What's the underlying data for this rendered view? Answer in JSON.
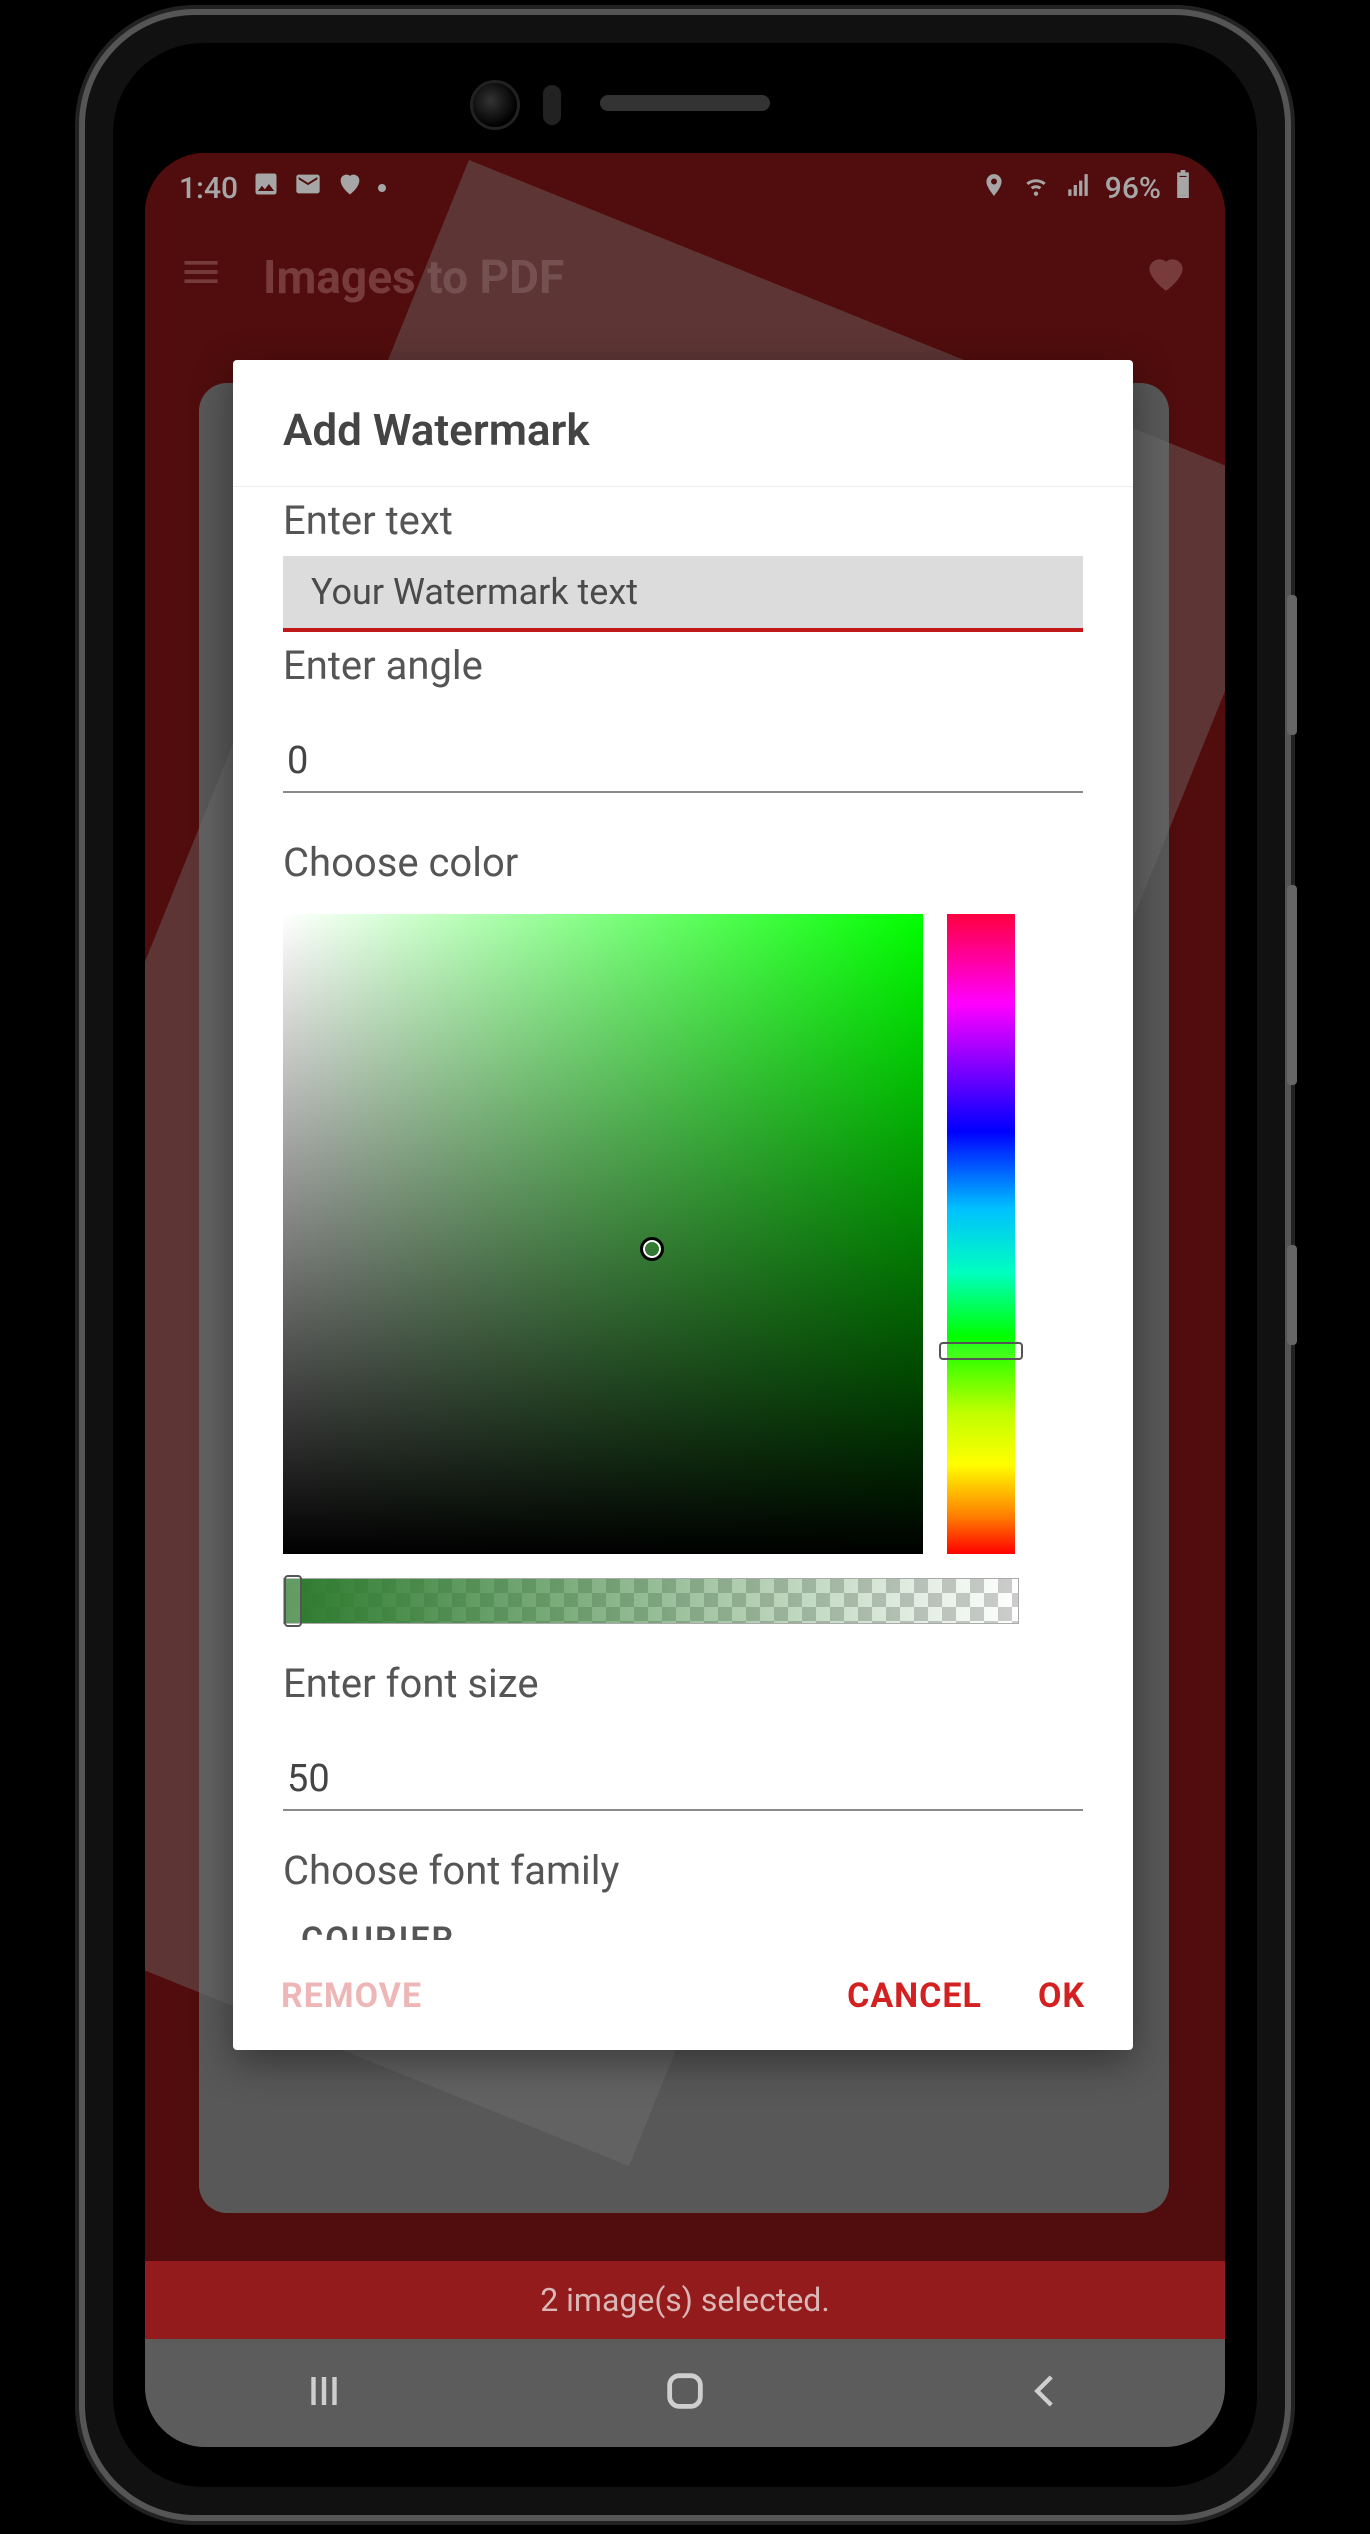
{
  "statusbar": {
    "time": "1:40",
    "battery_text": "96%"
  },
  "appbar": {
    "title": "Images to PDF"
  },
  "dialog": {
    "title": "Add Watermark",
    "labels": {
      "enter_text": "Enter text",
      "enter_angle": "Enter angle",
      "choose_color": "Choose color",
      "enter_font_size": "Enter font size",
      "choose_font_family": "Choose font family"
    },
    "fields": {
      "watermark_placeholder": "Your Watermark text",
      "angle_value": "0",
      "font_size_value": "50",
      "font_family_value": "COURIER"
    },
    "color": {
      "hue_deg": 120,
      "preview_hex": "#2c7a2d"
    },
    "buttons": {
      "remove": "REMOVE",
      "cancel": "CANCEL",
      "ok": "OK"
    }
  },
  "bottom_banner": "2 image(s) selected.",
  "icons": {
    "hamburger": "menu-icon",
    "heart": "heart-icon",
    "location": "location-icon",
    "wifi": "wifi-icon",
    "signal": "signal-icon",
    "battery": "battery-icon",
    "picture": "picture-icon",
    "mail": "mail-icon",
    "heart_small": "heart-small-icon",
    "nav_recent": "nav-recent-icon",
    "nav_home": "nav-home-icon",
    "nav_back": "nav-back-icon"
  }
}
